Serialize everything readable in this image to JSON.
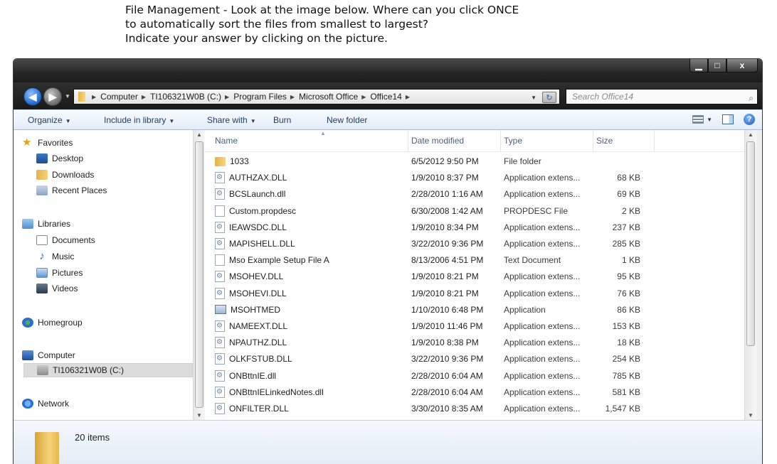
{
  "question": {
    "line1": "File Management - Look at the image below. Where can you click ONCE",
    "line2": "to automatically sort the files from smallest to largest?",
    "line3": "Indicate your answer by clicking on the picture."
  },
  "window_controls": {
    "minimize": "▁",
    "maximize": "□",
    "close": "x"
  },
  "address": {
    "crumbs": [
      "Computer",
      "TI106321W0B (C:)",
      "Program Files",
      "Microsoft Office",
      "Office14"
    ],
    "refresh": "↻"
  },
  "search": {
    "placeholder": "Search Office14",
    "icon": "search-icon"
  },
  "toolbar": {
    "organize": "Organize",
    "include_in_library": "Include in library",
    "share_with": "Share with",
    "burn": "Burn",
    "new_folder": "New folder",
    "help": "?"
  },
  "nav": {
    "favorites": "Favorites",
    "desktop": "Desktop",
    "downloads": "Downloads",
    "recent_places": "Recent Places",
    "libraries": "Libraries",
    "documents": "Documents",
    "music": "Music",
    "pictures": "Pictures",
    "videos": "Videos",
    "homegroup": "Homegroup",
    "computer": "Computer",
    "drive": "TI106321W0B (C:)",
    "network": "Network"
  },
  "columns": {
    "name": "Name",
    "date": "Date modified",
    "type": "Type",
    "size": "Size"
  },
  "files": [
    {
      "name": "1033",
      "date": "6/5/2012 9:50 PM",
      "type": "File folder",
      "size": "",
      "icon": "folder"
    },
    {
      "name": "AUTHZAX.DLL",
      "date": "1/9/2010 8:37 PM",
      "type": "Application extens...",
      "size": "68 KB",
      "icon": "dll"
    },
    {
      "name": "BCSLaunch.dll",
      "date": "2/28/2010 1:16 AM",
      "type": "Application extens...",
      "size": "69 KB",
      "icon": "dll"
    },
    {
      "name": "Custom.propdesc",
      "date": "6/30/2008 1:42 AM",
      "type": "PROPDESC File",
      "size": "2 KB",
      "icon": "file"
    },
    {
      "name": "IEAWSDC.DLL",
      "date": "1/9/2010 8:34 PM",
      "type": "Application extens...",
      "size": "237 KB",
      "icon": "dll"
    },
    {
      "name": "MAPISHELL.DLL",
      "date": "3/22/2010 9:36 PM",
      "type": "Application extens...",
      "size": "285 KB",
      "icon": "dll"
    },
    {
      "name": "Mso Example Setup File A",
      "date": "8/13/2006 4:51 PM",
      "type": "Text Document",
      "size": "1 KB",
      "icon": "file"
    },
    {
      "name": "MSOHEV.DLL",
      "date": "1/9/2010 8:21 PM",
      "type": "Application extens...",
      "size": "95 KB",
      "icon": "dll"
    },
    {
      "name": "MSOHEVI.DLL",
      "date": "1/9/2010 8:21 PM",
      "type": "Application extens...",
      "size": "76 KB",
      "icon": "dll"
    },
    {
      "name": "MSOHTMED",
      "date": "1/10/2010 6:48 PM",
      "type": "Application",
      "size": "86 KB",
      "icon": "app"
    },
    {
      "name": "NAMEEXT.DLL",
      "date": "1/9/2010 11:46 PM",
      "type": "Application extens...",
      "size": "153 KB",
      "icon": "dll"
    },
    {
      "name": "NPAUTHZ.DLL",
      "date": "1/9/2010 8:38 PM",
      "type": "Application extens...",
      "size": "18 KB",
      "icon": "dll"
    },
    {
      "name": "OLKFSTUB.DLL",
      "date": "3/22/2010 9:36 PM",
      "type": "Application extens...",
      "size": "254 KB",
      "icon": "dll"
    },
    {
      "name": "ONBttnIE.dll",
      "date": "2/28/2010 6:04 AM",
      "type": "Application extens...",
      "size": "785 KB",
      "icon": "dll"
    },
    {
      "name": "ONBttnIELinkedNotes.dll",
      "date": "2/28/2010 6:04 AM",
      "type": "Application extens...",
      "size": "581 KB",
      "icon": "dll"
    },
    {
      "name": "ONFILTER.DLL",
      "date": "3/30/2010 8:35 AM",
      "type": "Application extens...",
      "size": "1,547 KB",
      "icon": "dll"
    }
  ],
  "status": {
    "item_count": "20 items"
  }
}
